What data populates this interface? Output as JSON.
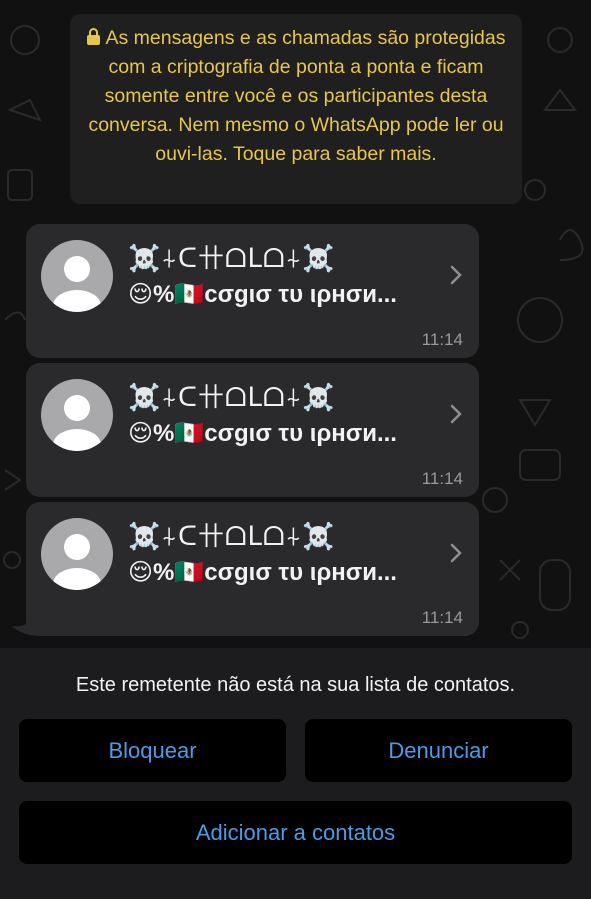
{
  "encryption_notice": {
    "text": "As mensagens e as chamadas são protegidas com a criptografia de ponta a ponta e ficam somente entre você e os participantes desta conversa. Nem mesmo o WhatsApp pode ler ou ouvi-las. Toque para saber mais.",
    "icon": "lock-icon",
    "color": "#e8c64a"
  },
  "messages": [
    {
      "name": "☠️⍭ᑕ卄ᗝᒪᗝ⍭☠️",
      "preview": "😌%🇲🇽cσgισ τυ ιρнσи...",
      "time": "11:14"
    },
    {
      "name": "☠️⍭ᑕ卄ᗝᒪᗝ⍭☠️",
      "preview": "😌%🇲🇽cσgισ τυ ιρнσи...",
      "time": "11:14"
    },
    {
      "name": "☠️⍭ᑕ卄ᗝᒪᗝ⍭☠️",
      "preview": "😌%🇲🇽cσgισ τυ ιρнσи...",
      "time": "11:14"
    }
  ],
  "footer": {
    "notice": "Este remetente não está na sua lista de contatos.",
    "block_label": "Bloquear",
    "report_label": "Denunciar",
    "add_label": "Adicionar a contatos"
  },
  "colors": {
    "accent": "#4a9be8",
    "bubble": "#2a2a2c",
    "background": "#111111"
  }
}
